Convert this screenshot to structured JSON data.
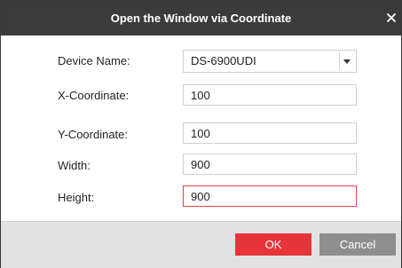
{
  "dialog": {
    "title": "Open the Window via Coordinate"
  },
  "icons": {
    "close": "close-icon",
    "dropdown": "chevron-down-icon"
  },
  "form": {
    "device_name": {
      "label": "Device Name:",
      "value": "DS-6900UDI"
    },
    "x_coordinate": {
      "label": "X-Coordinate:",
      "value": "100"
    },
    "y_coordinate": {
      "label": "Y-Coordinate:",
      "value": "100"
    },
    "width": {
      "label": "Width:",
      "value": "900"
    },
    "height": {
      "label": "Height:",
      "value": "900"
    }
  },
  "buttons": {
    "ok": "OK",
    "cancel": "Cancel"
  },
  "colors": {
    "titlebar": "#3b3b3b",
    "primary": "#e5353b",
    "secondary": "#8e8e8e",
    "invalid_border": "#e04545"
  }
}
